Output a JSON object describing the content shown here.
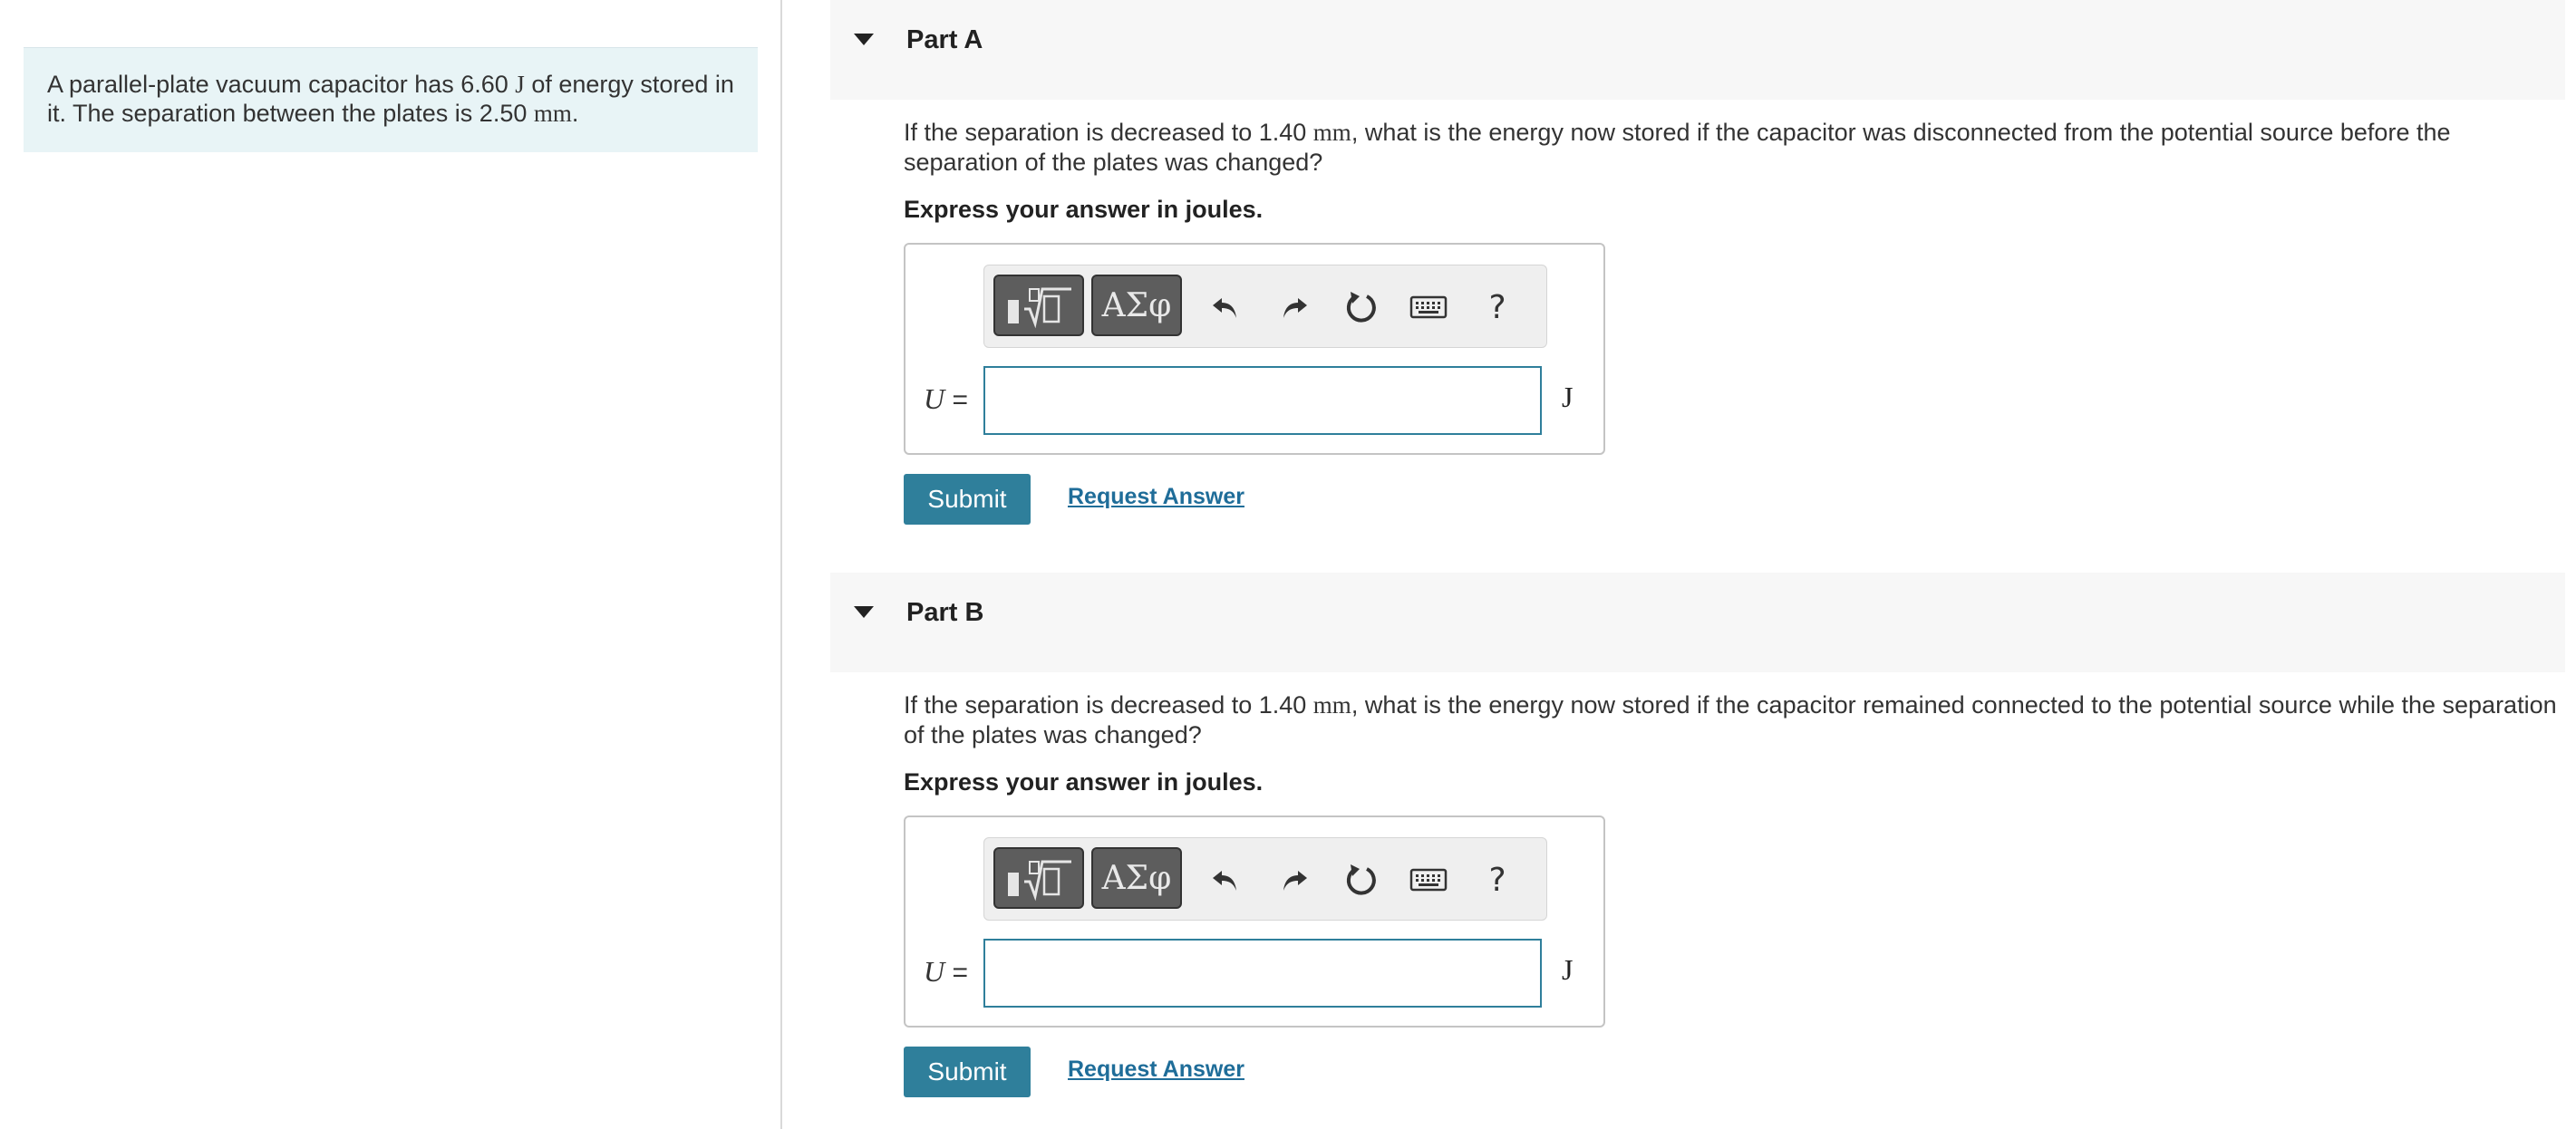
{
  "problem": {
    "text_before_energy": "A parallel-plate vacuum capacitor has 6.60 ",
    "energy_unit": "J",
    "text_after_energy": " of energy stored in it. The separation between the plates is 2.50 ",
    "separation_unit": "mm",
    "text_end": "."
  },
  "toolbar": {
    "templates_icon": "math-templates-icon",
    "greek_label": "ΑΣφ",
    "undo_icon": "undo-icon",
    "redo_icon": "redo-icon",
    "reset_icon": "reset-icon",
    "keyboard_icon": "keyboard-icon",
    "help_label": "?"
  },
  "parts": [
    {
      "title": "Part A",
      "question_start": "If the separation is decreased to 1.40 ",
      "question_unit": "mm",
      "question_rest": ", what is the energy now stored if the capacitor was disconnected from the potential source before the separation of the plates was changed?",
      "express": "Express your answer in joules.",
      "variable": "U",
      "equals": "=",
      "input_value": "",
      "unit": "J",
      "submit_label": "Submit",
      "request_label": "Request Answer"
    },
    {
      "title": "Part B",
      "question_start": "If the separation is decreased to 1.40 ",
      "question_unit": "mm",
      "question_rest": ", what is the energy now stored if the capacitor remained connected to the potential source while the separation of the plates was changed?",
      "express": "Express your answer in joules.",
      "variable": "U",
      "equals": "=",
      "input_value": "",
      "unit": "J",
      "submit_label": "Submit",
      "request_label": "Request Answer"
    }
  ],
  "colors": {
    "accent": "#2f7f9b",
    "problem_bg": "#e8f4f6",
    "header_bg": "#f7f7f7"
  }
}
